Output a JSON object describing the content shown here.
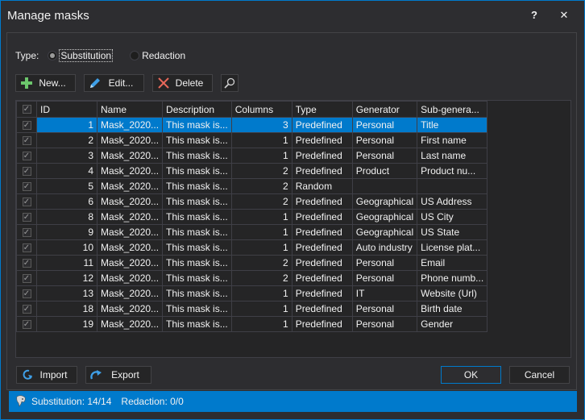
{
  "window": {
    "title": "Manage masks",
    "help_label": "?",
    "close_label": "✕"
  },
  "type_selector": {
    "label": "Type:",
    "options": [
      {
        "label": "Substitution",
        "checked": true
      },
      {
        "label": "Redaction",
        "checked": false
      }
    ]
  },
  "toolbar": {
    "new_label": "New...",
    "edit_label": "Edit...",
    "delete_label": "Delete",
    "icons": {
      "new": "plus-icon",
      "edit": "pencil-icon",
      "delete": "x-icon",
      "search": "search-icon"
    }
  },
  "grid": {
    "columns": [
      "ID",
      "Name",
      "Description",
      "Columns",
      "Type",
      "Generator",
      "Sub-genera..."
    ],
    "rows": [
      {
        "checked": true,
        "id": "1",
        "name": "Mask_2020...",
        "description": "This mask is...",
        "columns": "3",
        "type": "Predefined",
        "generator": "Personal",
        "subgenerator": "Title",
        "selected": true
      },
      {
        "checked": true,
        "id": "2",
        "name": "Mask_2020...",
        "description": "This mask is...",
        "columns": "1",
        "type": "Predefined",
        "generator": "Personal",
        "subgenerator": "First name"
      },
      {
        "checked": true,
        "id": "3",
        "name": "Mask_2020...",
        "description": "This mask is...",
        "columns": "1",
        "type": "Predefined",
        "generator": "Personal",
        "subgenerator": "Last name"
      },
      {
        "checked": true,
        "id": "4",
        "name": "Mask_2020...",
        "description": "This mask is...",
        "columns": "2",
        "type": "Predefined",
        "generator": "Product",
        "subgenerator": "Product nu..."
      },
      {
        "checked": true,
        "id": "5",
        "name": "Mask_2020...",
        "description": "This mask is...",
        "columns": "2",
        "type": "Random",
        "generator": "",
        "subgenerator": ""
      },
      {
        "checked": true,
        "id": "6",
        "name": "Mask_2020...",
        "description": "This mask is...",
        "columns": "2",
        "type": "Predefined",
        "generator": "Geographical",
        "subgenerator": "US Address"
      },
      {
        "checked": true,
        "id": "8",
        "name": "Mask_2020...",
        "description": "This mask is...",
        "columns": "1",
        "type": "Predefined",
        "generator": "Geographical",
        "subgenerator": "US City"
      },
      {
        "checked": true,
        "id": "9",
        "name": "Mask_2020...",
        "description": "This mask is...",
        "columns": "1",
        "type": "Predefined",
        "generator": "Geographical",
        "subgenerator": "US State"
      },
      {
        "checked": true,
        "id": "10",
        "name": "Mask_2020...",
        "description": "This mask is...",
        "columns": "1",
        "type": "Predefined",
        "generator": "Auto industry",
        "subgenerator": "License plat..."
      },
      {
        "checked": true,
        "id": "11",
        "name": "Mask_2020...",
        "description": "This mask is...",
        "columns": "2",
        "type": "Predefined",
        "generator": "Personal",
        "subgenerator": "Email"
      },
      {
        "checked": true,
        "id": "12",
        "name": "Mask_2020...",
        "description": "This mask is...",
        "columns": "2",
        "type": "Predefined",
        "generator": "Personal",
        "subgenerator": "Phone numb..."
      },
      {
        "checked": true,
        "id": "13",
        "name": "Mask_2020...",
        "description": "This mask is...",
        "columns": "1",
        "type": "Predefined",
        "generator": "IT",
        "subgenerator": "Website (Url)"
      },
      {
        "checked": true,
        "id": "18",
        "name": "Mask_2020...",
        "description": "This mask is...",
        "columns": "1",
        "type": "Predefined",
        "generator": "Personal",
        "subgenerator": "Birth date"
      },
      {
        "checked": true,
        "id": "19",
        "name": "Mask_2020...",
        "description": "This mask is...",
        "columns": "1",
        "type": "Predefined",
        "generator": "Personal",
        "subgenerator": "Gender"
      }
    ]
  },
  "footer": {
    "import_label": "Import",
    "export_label": "Export",
    "ok_label": "OK",
    "cancel_label": "Cancel"
  },
  "status": {
    "substitution": "Substitution: 14/14",
    "redaction": "Redaction: 0/0"
  },
  "colors": {
    "accent": "#007acc",
    "background": "#2d2d30",
    "grid_background": "#252526",
    "plus_green": "#6cc66c",
    "pencil_blue": "#3fa0e8",
    "delete_red": "#e8685a"
  }
}
